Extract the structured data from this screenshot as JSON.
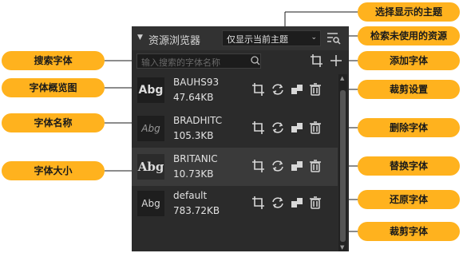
{
  "panel": {
    "title": "资源浏览器",
    "theme_select": "仅显示当前主题",
    "search_placeholder": "输入搜索的字体名称"
  },
  "fonts": [
    {
      "thumb": "Abg",
      "name": "BAUHS93",
      "size": "47.64KB"
    },
    {
      "thumb": "Abg",
      "name": "BRADHITC",
      "size": "105.3KB"
    },
    {
      "thumb": "Abg",
      "name": "BRITANIC",
      "size": "10.73KB"
    },
    {
      "thumb": "Abg",
      "name": "default",
      "size": "783.72KB"
    }
  ],
  "callouts": {
    "select_theme": "选择显示的主题",
    "search_unused": "检索未使用的资源",
    "search_font": "搜索字体",
    "add_font": "添加字体",
    "font_preview": "字体概览图",
    "crop_settings": "裁剪设置",
    "font_name": "字体名称",
    "delete_font": "删除字体",
    "font_size": "字体大小",
    "replace_font": "替换字体",
    "restore_font": "还原字体",
    "crop_font": "裁剪字体"
  },
  "colors": {
    "accent": "#ffb21e",
    "panel_bg": "#2b2b2b"
  }
}
